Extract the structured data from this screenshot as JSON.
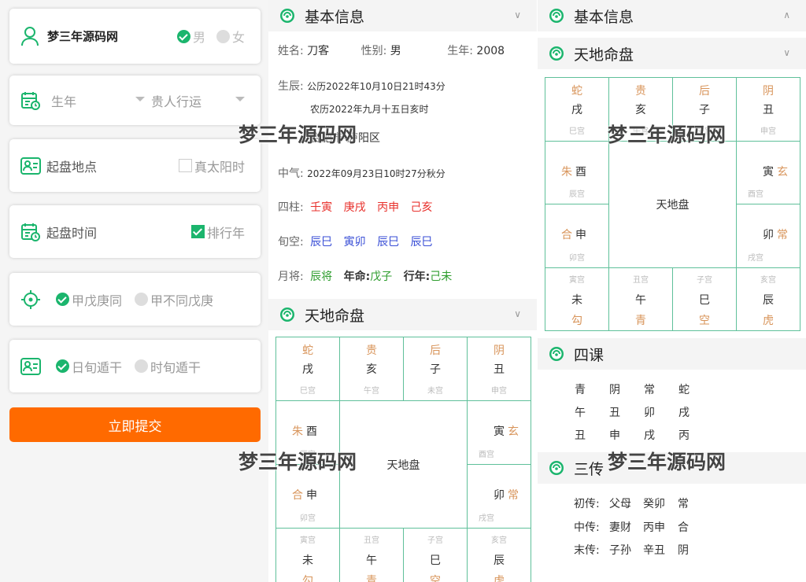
{
  "form": {
    "name": "梦三年源码网",
    "gender_male": "男",
    "gender_female": "女",
    "year_label": "生年",
    "guiren": "贵人行运",
    "place_label": "起盘地点",
    "true_solar": "真太阳时",
    "time_label": "起盘时间",
    "paihang": "排行年",
    "opt_a": "甲戊庚同",
    "opt_b": "甲不同戊庚",
    "opt_c": "日旬遁干",
    "opt_d": "时旬遁干",
    "submit": "立即提交"
  },
  "basic": {
    "title": "基本信息",
    "name_label": "姓名:",
    "name": "刀客",
    "gender_label": "性别:",
    "gender": "男",
    "year_label": "生年:",
    "year": "2008",
    "chen_label": "生辰:",
    "gongli": "公历2022年10月10日21时43分",
    "nongli": "农历2022年九月十五日亥时",
    "place": "合肥市-庐阳区",
    "zhongqi_label": "中气:",
    "zhongqi": "2022年09月23日10时27分秋分",
    "sizhu_label": "四柱:",
    "sizhu": [
      "壬寅",
      "庚戌",
      "丙申",
      "己亥"
    ],
    "xunkong_label": "旬空:",
    "xunkong": [
      "辰巳",
      "寅卯",
      "辰巳",
      "辰巳"
    ],
    "yuejiang_label": "月将:",
    "yuejiang": "辰将",
    "nianming_label": "年命:",
    "nianming": "戊子",
    "xingnian_label": "行年:",
    "xingnian": "己未"
  },
  "pan": {
    "title": "天地命盘",
    "center": "天地盘",
    "top": [
      {
        "gen": "蛇",
        "zhi": "戌",
        "gong": "巳宫"
      },
      {
        "gen": "贵",
        "zhi": "亥",
        "gong": "午宫"
      },
      {
        "gen": "后",
        "zhi": "子",
        "gong": "未宫"
      },
      {
        "gen": "阴",
        "zhi": "丑",
        "gong": "申宫"
      }
    ],
    "left": [
      {
        "gen": "朱",
        "zhi": "酉",
        "gong": "辰宫"
      },
      {
        "gen": "合",
        "zhi": "申",
        "gong": "卯宫"
      }
    ],
    "right": [
      {
        "gen": "玄",
        "zhi": "寅",
        "gong": "酉宫"
      },
      {
        "gen": "常",
        "zhi": "卯",
        "gong": "戌宫"
      }
    ],
    "bottom": [
      {
        "gen": "勾",
        "zhi": "未",
        "gong": "寅宫"
      },
      {
        "gen": "青",
        "zhi": "午",
        "gong": "丑宫"
      },
      {
        "gen": "空",
        "zhi": "巳",
        "gong": "子宫"
      },
      {
        "gen": "虎",
        "zhi": "辰",
        "gong": "亥宫"
      }
    ]
  },
  "sike": {
    "title": "四课",
    "rows": [
      [
        "青",
        "阴",
        "常",
        "蛇"
      ],
      [
        "午",
        "丑",
        "卯",
        "戌"
      ],
      [
        "丑",
        "申",
        "戌",
        "丙"
      ]
    ]
  },
  "sanchuan": {
    "title": "三传",
    "rows": [
      [
        "初传:",
        "父母",
        "癸卯",
        "常"
      ],
      [
        "中传:",
        "妻财",
        "丙申",
        "合"
      ],
      [
        "末传:",
        "子孙",
        "辛丑",
        "阴"
      ]
    ]
  },
  "watermark": "梦三年源码网",
  "colors": {
    "green": "#1bb56d",
    "orange": "#ff6a00",
    "grid": "#5fc09a",
    "tan": "#d8945a",
    "red": "#e8322d",
    "blue": "#3a4fd6",
    "darkgreen": "#2e9d2e"
  }
}
